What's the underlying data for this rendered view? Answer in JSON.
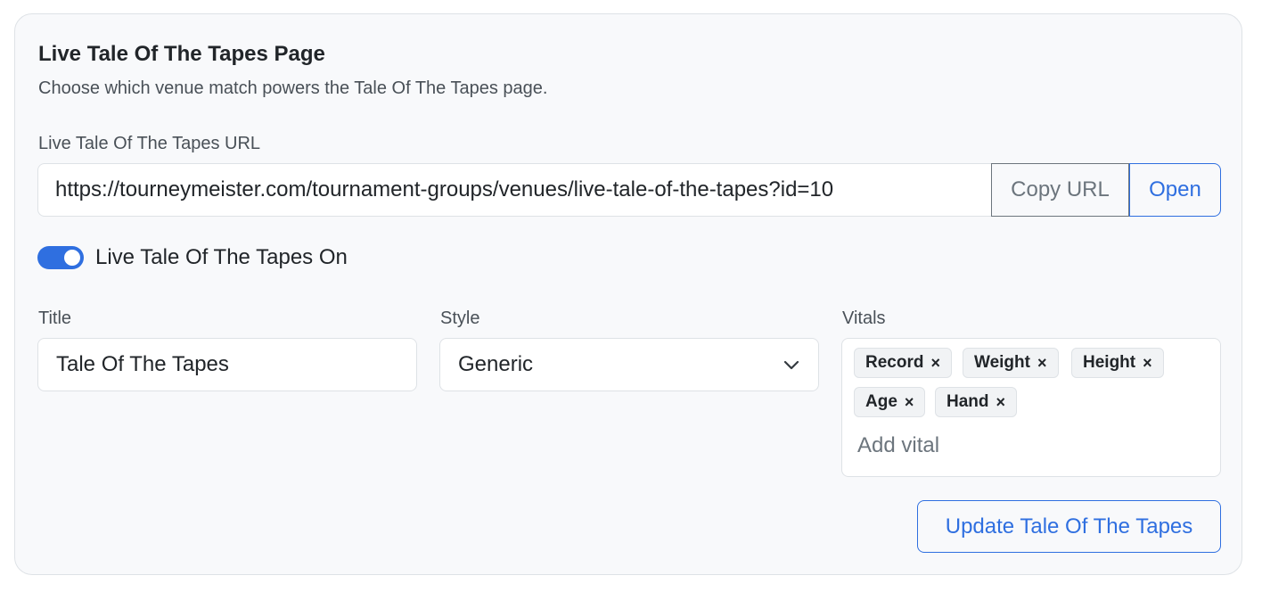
{
  "section": {
    "title": "Live Tale Of The Tapes Page",
    "subtitle": "Choose which venue match powers the Tale Of The Tapes page."
  },
  "url_field": {
    "label": "Live Tale Of The Tapes URL",
    "value": "https://tourneymeister.com/tournament-groups/venues/live-tale-of-the-tapes?id=10",
    "copy_label": "Copy URL",
    "open_label": "Open"
  },
  "toggle": {
    "label": "Live Tale Of The Tapes On",
    "on": true
  },
  "title_field": {
    "label": "Title",
    "value": "Tale Of The Tapes"
  },
  "style_field": {
    "label": "Style",
    "selected": "Generic"
  },
  "vitals_field": {
    "label": "Vitals",
    "chips": [
      "Record",
      "Weight",
      "Height",
      "Age",
      "Hand"
    ],
    "remove_glyph": "×",
    "placeholder": "Add vital"
  },
  "update_button": {
    "label": "Update Tale Of The Tapes"
  },
  "colors": {
    "accent": "#2f6fe0",
    "card_bg": "#f8f9fb",
    "border": "#dee2e6",
    "muted": "#6c757d"
  },
  "icons": {
    "style_select": "chevron-down-icon",
    "chip_remove": "close-icon"
  }
}
